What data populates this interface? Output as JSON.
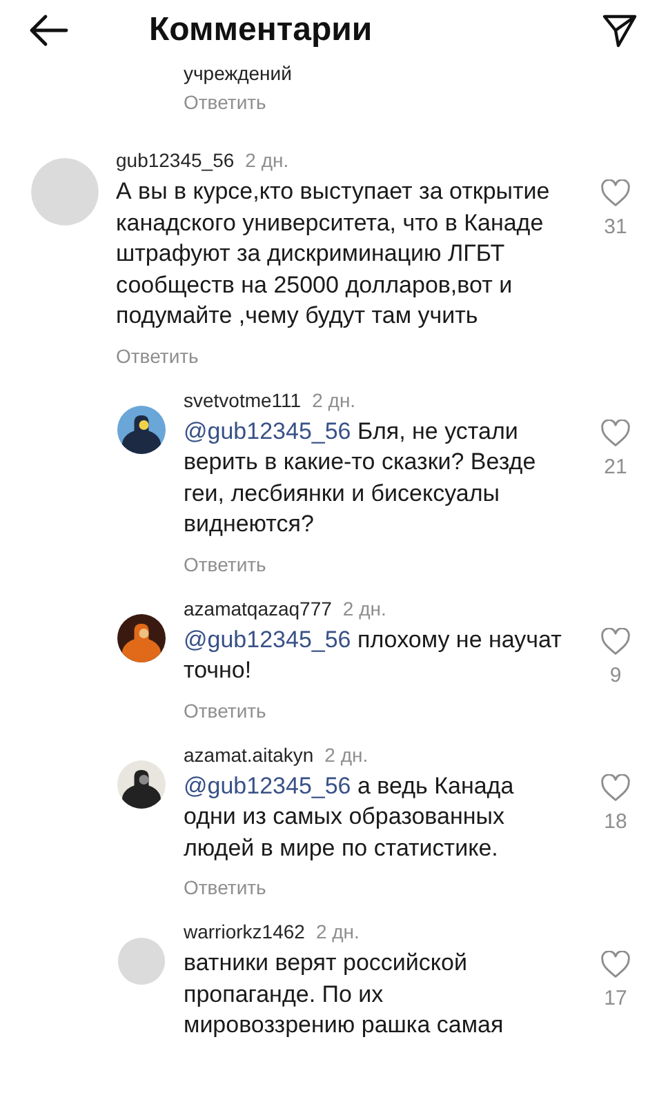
{
  "header": {
    "title": "Комментарии"
  },
  "fragment": {
    "text": "учреждений",
    "reply_label": "Ответить"
  },
  "comments": [
    {
      "kind": "comment",
      "avatar": {
        "kind": "default"
      },
      "username": "gub12345_56",
      "time": "2 дн.",
      "text": "А вы в курсе,кто выступает за открытие\nканадского университета, что в Канаде\nштрафуют за дискриминацию ЛГБТ\nсообществ на 25000 долларов,вот и\nподумайте ,чему будут там учить",
      "likes": "31",
      "reply_label": "Ответить"
    },
    {
      "kind": "reply",
      "username": "svetvotme111",
      "time": "2 дн.",
      "mention": "@gub12345_56",
      "text": " Бля, не устали\nверить в какие-то сказки? Везде\nгеи, лесбиянки и бисексуалы\nвиднеются?",
      "likes": "21",
      "reply_label": "Ответить"
    },
    {
      "kind": "reply",
      "username": "azamatqazaq777",
      "time": "2 дн.",
      "mention": "@gub12345_56",
      "text": " плохому не научат\nточно!",
      "likes": "9",
      "reply_label": "Ответить"
    },
    {
      "kind": "reply",
      "username": "azamat.aitakyn",
      "time": "2 дн.",
      "mention": "@gub12345_56",
      "text": " а ведь Канада\nодни из самых образованных\nлюдей в мире по статистике.",
      "likes": "18",
      "reply_label": "Ответить"
    },
    {
      "kind": "reply",
      "avatar": {
        "kind": "default"
      },
      "username": "warriorkz1462",
      "time": "2 дн.",
      "text": "ватники верят российской\nпропаганде. По их\nмировоззрению рашка самая",
      "likes": "17"
    }
  ]
}
